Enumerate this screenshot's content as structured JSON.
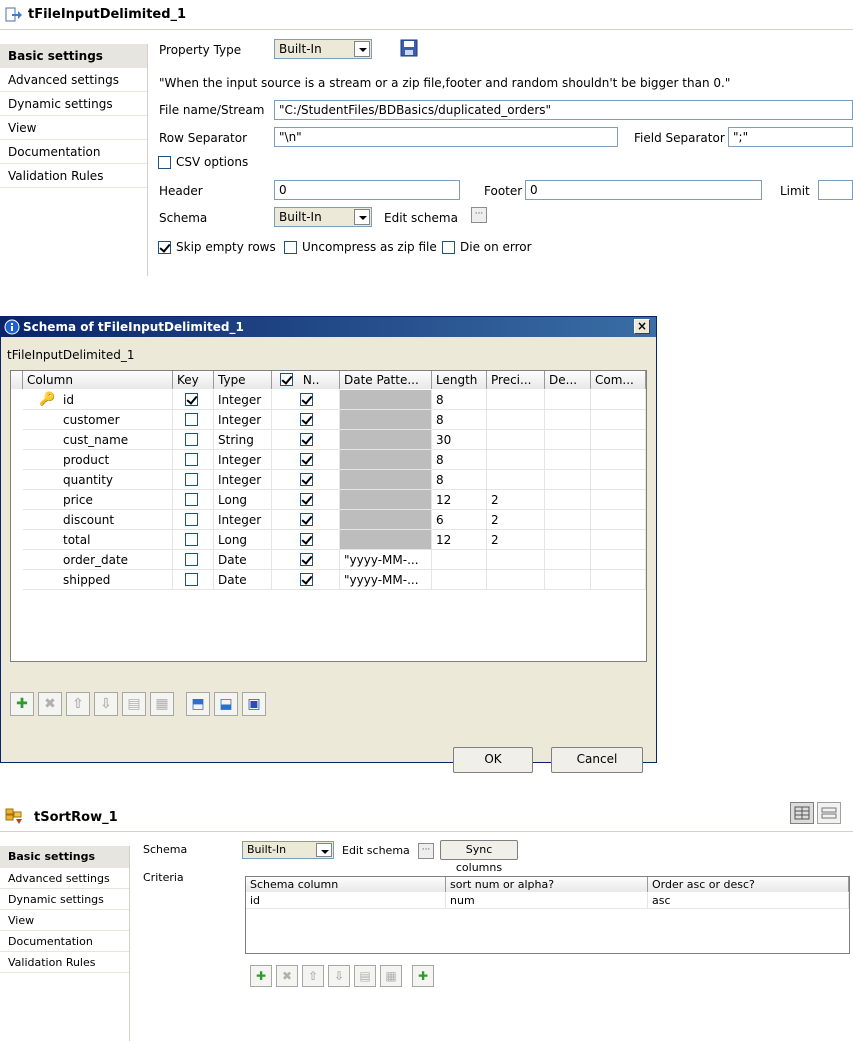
{
  "panel1": {
    "title": "tFileInputDelimited_1",
    "tabs": [
      "Basic settings",
      "Advanced settings",
      "Dynamic settings",
      "View",
      "Documentation",
      "Validation Rules"
    ],
    "property_type_label": "Property Type",
    "property_type_value": "Built-In",
    "note": "\"When the input source is a stream or a zip file,footer and random shouldn't be bigger than 0.\"",
    "file_label": "File name/Stream",
    "file_value": "\"C:/StudentFiles/BDBasics/duplicated_orders\"",
    "row_sep_label": "Row Separator",
    "row_sep_value": "\"\\n\"",
    "field_sep_label": "Field Separator",
    "field_sep_value": "\";\"",
    "csv_label": "CSV options",
    "header_label": "Header",
    "header_value": "0",
    "footer_label": "Footer",
    "footer_value": "0",
    "limit_label": "Limit",
    "schema_label": "Schema",
    "schema_value": "Built-In",
    "edit_schema_label": "Edit schema",
    "skip_label": "Skip empty rows",
    "uncompress_label": "Uncompress as zip file",
    "die_label": "Die on error"
  },
  "dialog": {
    "title": "Schema of tFileInputDelimited_1",
    "subtitle": "tFileInputDelimited_1",
    "columns": [
      "Column",
      "Key",
      "Type",
      "N..",
      "Date Patte...",
      "Length",
      "Preci...",
      "De...",
      "Com..."
    ],
    "rows": [
      {
        "name": "id",
        "key": true,
        "type": "Integer",
        "nullable": true,
        "pattern": "",
        "length": "8",
        "precision": ""
      },
      {
        "name": "customer",
        "key": false,
        "type": "Integer",
        "nullable": true,
        "pattern": "",
        "length": "8",
        "precision": ""
      },
      {
        "name": "cust_name",
        "key": false,
        "type": "String",
        "nullable": true,
        "pattern": "",
        "length": "30",
        "precision": ""
      },
      {
        "name": "product",
        "key": false,
        "type": "Integer",
        "nullable": true,
        "pattern": "",
        "length": "8",
        "precision": ""
      },
      {
        "name": "quantity",
        "key": false,
        "type": "Integer",
        "nullable": true,
        "pattern": "",
        "length": "8",
        "precision": ""
      },
      {
        "name": "price",
        "key": false,
        "type": "Long",
        "nullable": true,
        "pattern": "",
        "length": "12",
        "precision": "2"
      },
      {
        "name": "discount",
        "key": false,
        "type": "Integer",
        "nullable": true,
        "pattern": "",
        "length": "6",
        "precision": "2"
      },
      {
        "name": "total",
        "key": false,
        "type": "Long",
        "nullable": true,
        "pattern": "",
        "length": "12",
        "precision": "2"
      },
      {
        "name": "order_date",
        "key": false,
        "type": "Date",
        "nullable": true,
        "pattern": "\"yyyy-MM-...",
        "length": "",
        "precision": ""
      },
      {
        "name": "shipped",
        "key": false,
        "type": "Date",
        "nullable": true,
        "pattern": "\"yyyy-MM-...",
        "length": "",
        "precision": ""
      }
    ],
    "ok_label": "OK",
    "cancel_label": "Cancel"
  },
  "panel2": {
    "title": "tSortRow_1",
    "tabs": [
      "Basic settings",
      "Advanced settings",
      "Dynamic settings",
      "View",
      "Documentation",
      "Validation Rules"
    ],
    "schema_label": "Schema",
    "schema_value": "Built-In",
    "edit_schema_label": "Edit schema",
    "sync_label": "Sync columns",
    "criteria_label": "Criteria",
    "criteria_columns": [
      "Schema column",
      "sort num or alpha?",
      "Order asc or desc?"
    ],
    "criteria_rows": [
      {
        "col": "id",
        "sort": "num",
        "order": "asc"
      }
    ]
  },
  "colors": {
    "title_bar": "#0a246a",
    "dialog_bg": "#ece9d8",
    "field_border": "#7f9db9"
  }
}
